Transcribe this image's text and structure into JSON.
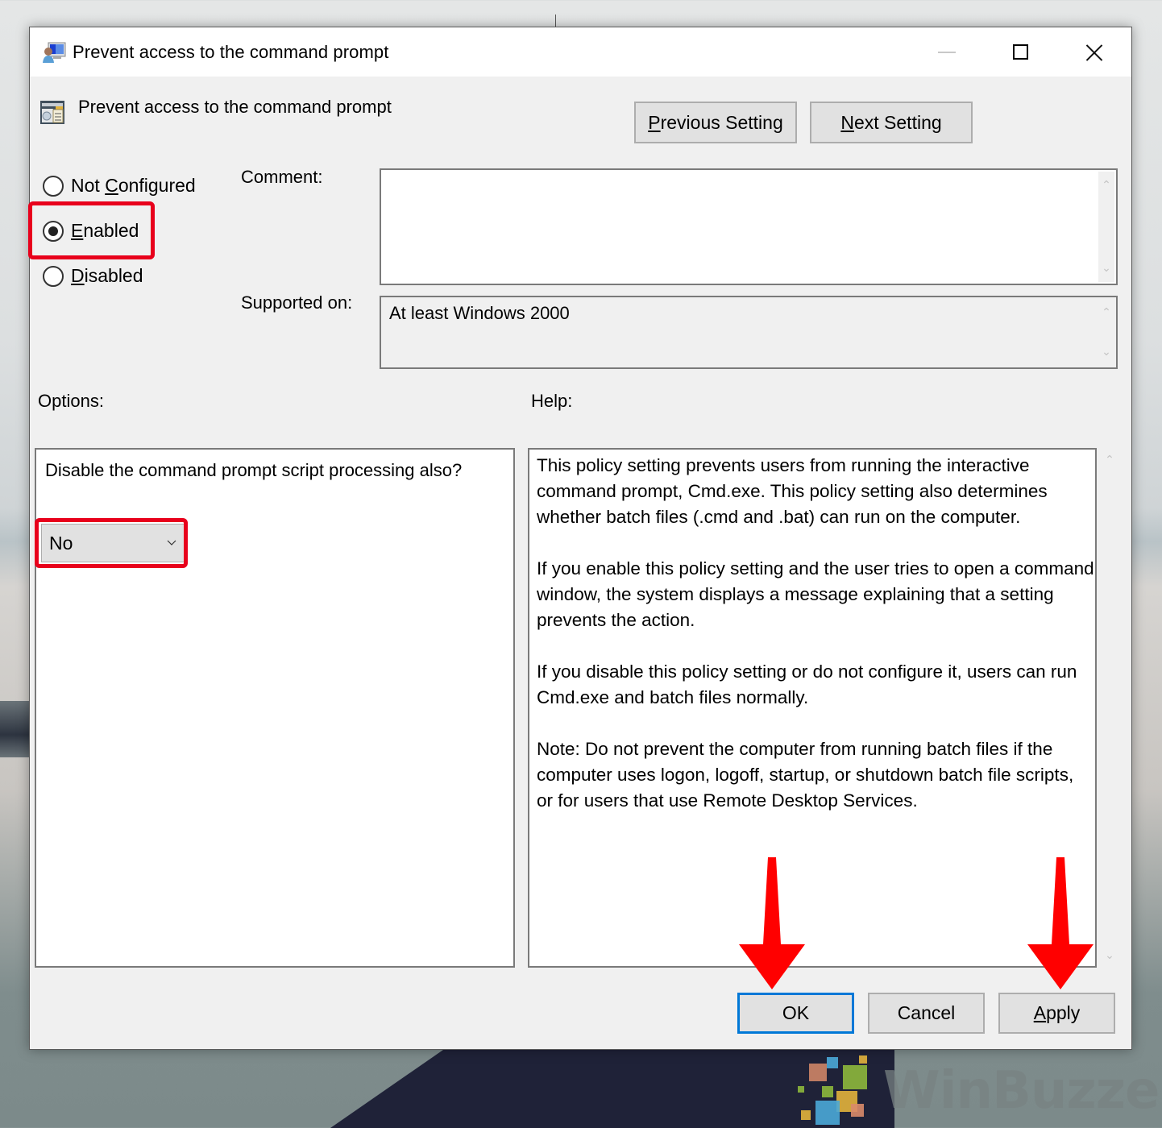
{
  "window": {
    "title": "Prevent access to the command prompt",
    "controls": {
      "minimize": "minimize-icon",
      "maximize": "maximize-icon",
      "close": "close-icon"
    }
  },
  "header": {
    "setting_name": "Prevent access to the command prompt",
    "previous_button": {
      "mnemonic": "P",
      "rest": "revious Setting"
    },
    "next_button": {
      "mnemonic": "N",
      "rest": "ext Setting"
    }
  },
  "state": {
    "options": [
      {
        "pre": "Not ",
        "mnemonic": "C",
        "rest": "onfigured",
        "checked": false
      },
      {
        "pre": "",
        "mnemonic": "E",
        "rest": "nabled",
        "checked": true
      },
      {
        "pre": "",
        "mnemonic": "D",
        "rest": "isabled",
        "checked": false
      }
    ],
    "selected": "Enabled"
  },
  "comment": {
    "label": "Comment:",
    "value": ""
  },
  "supported": {
    "label": "Supported on:",
    "value": "At least Windows 2000"
  },
  "options_panel": {
    "label": "Options:",
    "question": "Disable the command prompt script processing also?",
    "dropdown_value": "No"
  },
  "help_panel": {
    "label": "Help:",
    "paragraphs": [
      "This policy setting prevents users from running the interactive command prompt, Cmd.exe.  This policy setting also determines whether batch files (.cmd and .bat) can run on the computer.",
      "If you enable this policy setting and the user tries to open a command window, the system displays a message explaining that a setting prevents the action.",
      "If you disable this policy setting or do not configure it, users can run Cmd.exe and batch files normally.",
      "Note: Do not prevent the computer from running batch files if the computer uses logon, logoff, startup, or shutdown batch file scripts, or for users that use Remote Desktop Services."
    ]
  },
  "footer": {
    "ok_label": "OK",
    "cancel_label": "Cancel",
    "apply_button": {
      "mnemonic": "A",
      "rest": "pply"
    }
  },
  "annotations": {
    "highlight_color": "#e8001c",
    "arrow_color": "#ff0000",
    "focus_color": "#0078d7"
  },
  "watermark": {
    "text": "WinBuzzer"
  }
}
